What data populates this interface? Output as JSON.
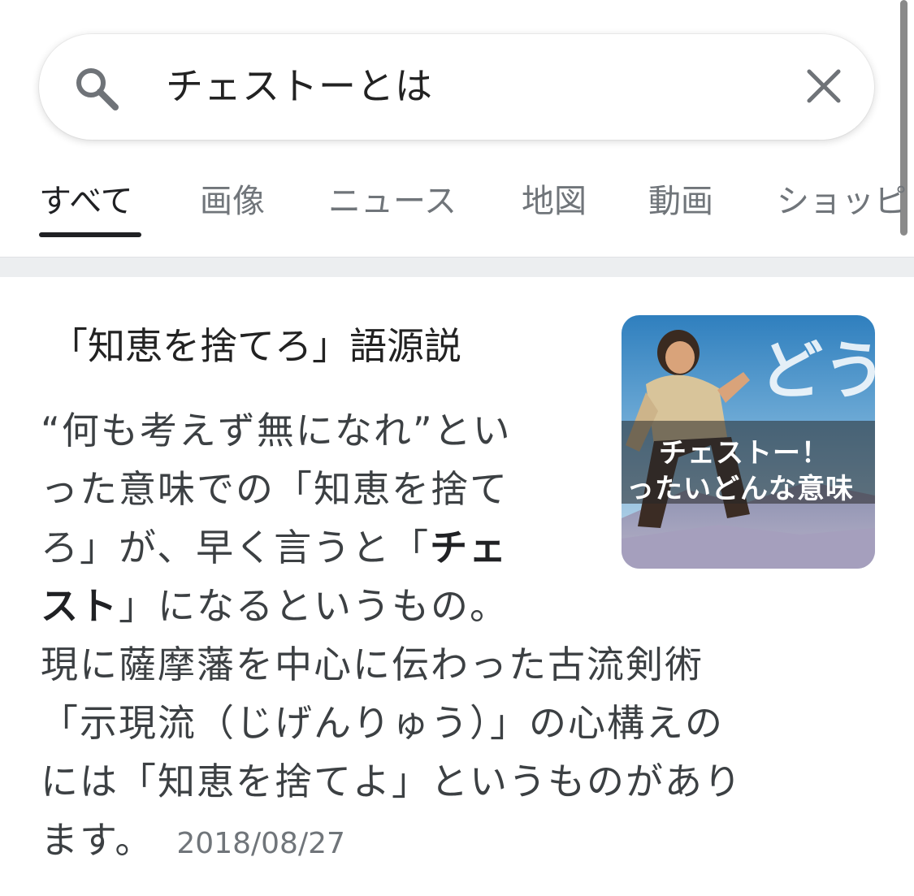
{
  "search": {
    "query": "チェストーとは"
  },
  "tabs": [
    {
      "label": "すべて",
      "active": true
    },
    {
      "label": "画像"
    },
    {
      "label": "ニュース"
    },
    {
      "label": "地図"
    },
    {
      "label": "動画"
    },
    {
      "label": "ショッピ"
    }
  ],
  "result": {
    "title": "「知恵を捨てろ」語源説",
    "snippet_lines": [
      [
        "“何も考えず無になれ”とい"
      ],
      [
        "った意味での「知恵を捨て"
      ],
      [
        "ろ」が、早く言うと「",
        "チェ"
      ],
      [
        "スト",
        "」になるというもの。"
      ],
      [
        "現に薩摩藩を中心に伝わった古流剣術"
      ],
      [
        "「示現流（じげんりゅう）」の心構えの"
      ],
      [
        "には「知恵を捨てよ」というものがあり"
      ],
      [
        "ます。"
      ]
    ],
    "date": "2018/08/27",
    "thumbnail": {
      "line1": "チェストー！",
      "line2": "ったいどんな意味",
      "overlay_glyph": "どう"
    }
  },
  "colors": {
    "text_primary": "#202124",
    "text_secondary": "#70757a",
    "divider": "#eceef0"
  }
}
